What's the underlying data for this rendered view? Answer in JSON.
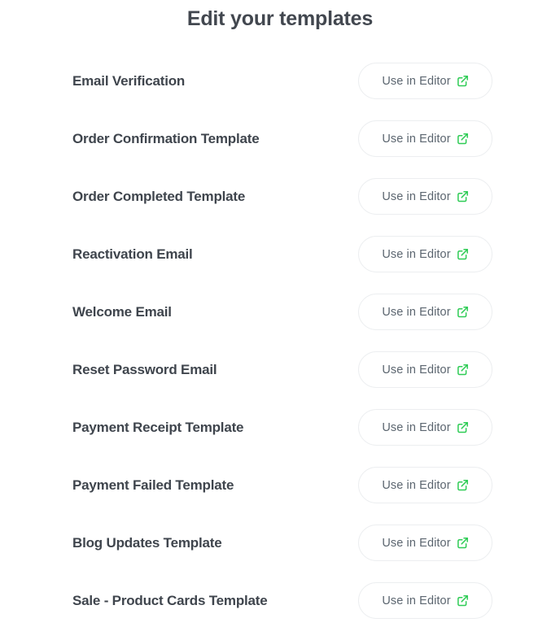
{
  "header": {
    "title": "Edit your templates"
  },
  "colors": {
    "page_background": "#ffffff",
    "title_text": "#42474f",
    "row_label_text": "#3f454d",
    "button_text": "#5c6670",
    "button_border": "#eceef0",
    "icon_accent": "#2ecc55"
  },
  "button": {
    "label": "Use in Editor",
    "icon": "external-link-icon"
  },
  "templates": [
    {
      "name": "Email Verification",
      "action_label": "Use in Editor"
    },
    {
      "name": "Order Confirmation Template",
      "action_label": "Use in Editor"
    },
    {
      "name": "Order Completed Template",
      "action_label": "Use in Editor"
    },
    {
      "name": "Reactivation Email",
      "action_label": "Use in Editor"
    },
    {
      "name": "Welcome Email",
      "action_label": "Use in Editor"
    },
    {
      "name": "Reset Password Email",
      "action_label": "Use in Editor"
    },
    {
      "name": "Payment Receipt Template",
      "action_label": "Use in Editor"
    },
    {
      "name": "Payment Failed Template",
      "action_label": "Use in Editor"
    },
    {
      "name": "Blog Updates Template",
      "action_label": "Use in Editor"
    },
    {
      "name": "Sale - Product Cards Template",
      "action_label": "Use in Editor"
    }
  ]
}
